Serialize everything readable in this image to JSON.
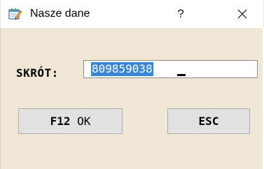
{
  "window": {
    "title": "Nasze dane",
    "help_label": "?",
    "app_icon": "notepad-pencil-icon",
    "close_icon": "close-icon"
  },
  "form": {
    "label": "SKRÓT:",
    "field_value": "809859038"
  },
  "buttons": {
    "ok_key": "F12",
    "ok_label": "OK",
    "esc_label": "ESC"
  },
  "colors": {
    "dialog_background": "#f0e7d6",
    "selection": "#3a86d6",
    "button_face": "#e1e1e1"
  }
}
